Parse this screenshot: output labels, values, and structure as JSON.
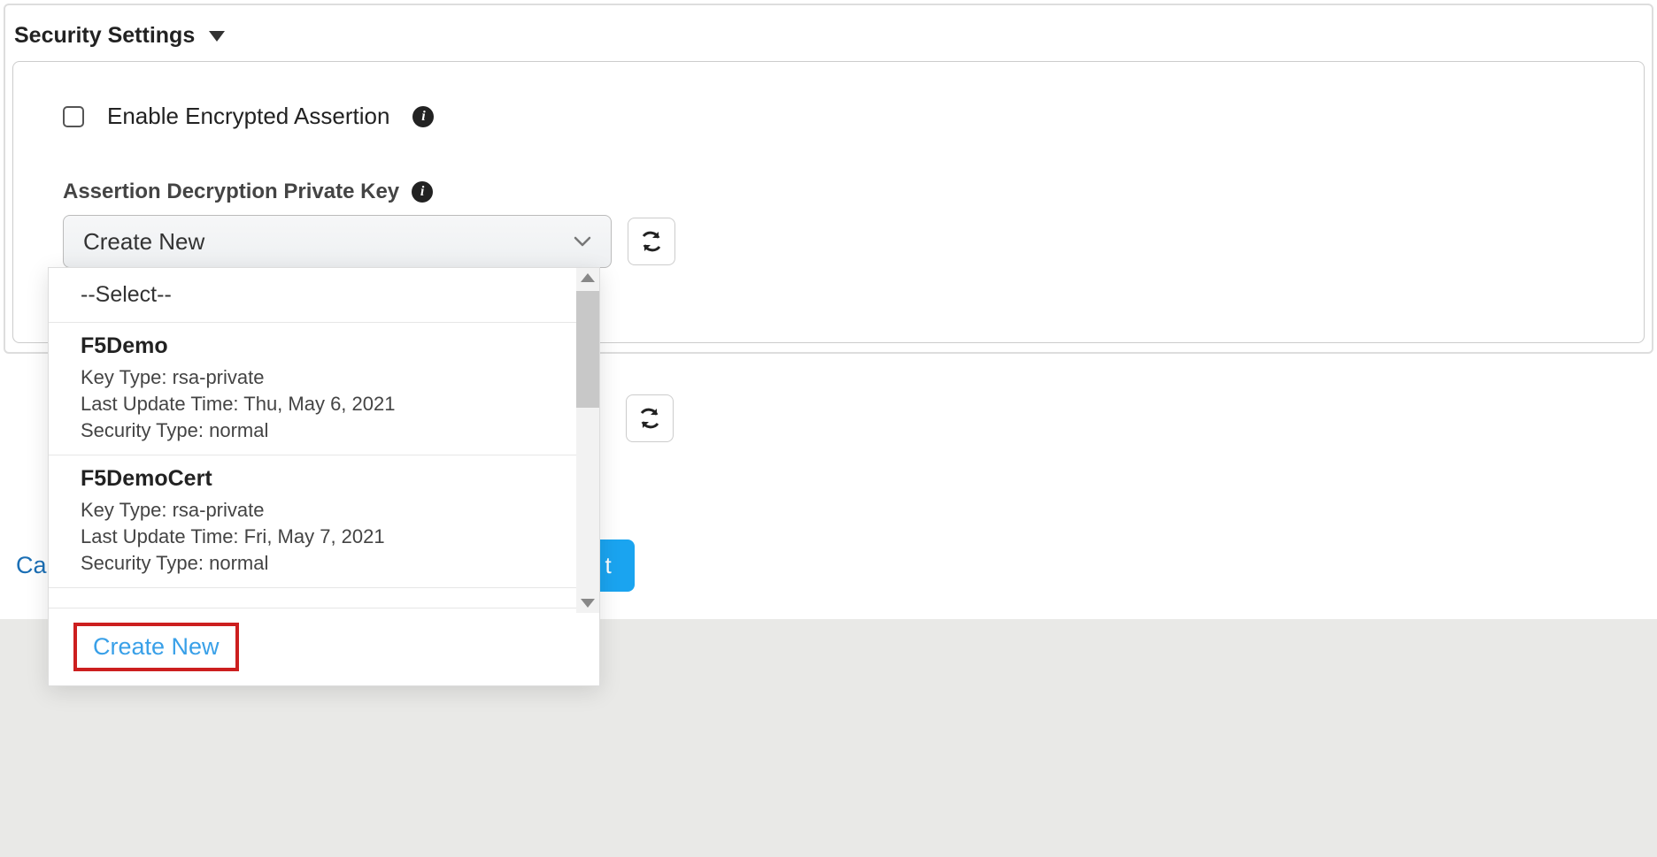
{
  "section": {
    "title": "Security Settings"
  },
  "checkbox": {
    "label": "Enable Encrypted Assertion"
  },
  "field": {
    "label": "Assertion Decryption Private Key",
    "selected": "Create New"
  },
  "dropdown": {
    "placeholder": "--Select--",
    "options": [
      {
        "name": "F5Demo",
        "keyTypeLabel": "Key Type:",
        "keyType": "rsa-private",
        "lastUpdateLabel": "Last Update Time:",
        "lastUpdate": "Thu, May 6, 2021",
        "securityTypeLabel": "Security Type:",
        "securityType": "normal"
      },
      {
        "name": "F5DemoCert",
        "keyTypeLabel": "Key Type:",
        "keyType": "rsa-private",
        "lastUpdateLabel": "Last Update Time:",
        "lastUpdate": "Fri, May 7, 2021",
        "securityTypeLabel": "Security Type:",
        "securityType": "normal"
      }
    ],
    "createNew": "Create New"
  },
  "footer": {
    "cancel": "Can",
    "next": "t"
  }
}
